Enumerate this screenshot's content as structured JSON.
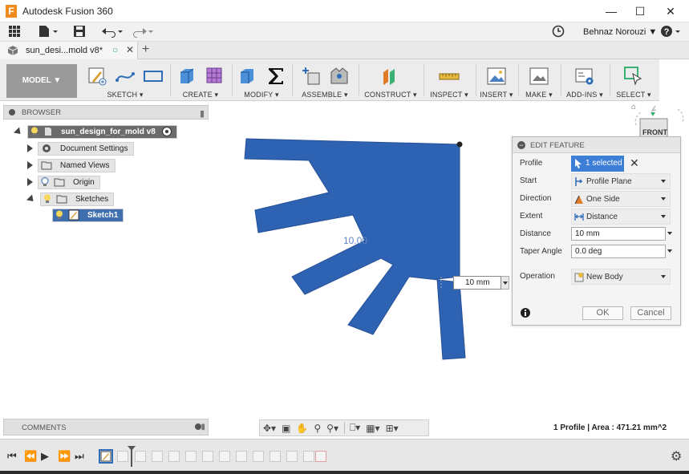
{
  "window": {
    "title": "Autodesk Fusion 360",
    "logo_letter": "F"
  },
  "qat": {
    "user": "Behnaz Norouzi ▼",
    "help": "?"
  },
  "tabs": {
    "document_title": "sun_desi...mold v8*",
    "plus": "+"
  },
  "ribbon": {
    "workspace": "MODEL ▼",
    "groups": [
      {
        "label": "SKETCH ▾"
      },
      {
        "label": "CREATE ▾"
      },
      {
        "label": "MODIFY ▾"
      },
      {
        "label": "ASSEMBLE ▾"
      },
      {
        "label": "CONSTRUCT ▾"
      },
      {
        "label": "INSPECT ▾"
      },
      {
        "label": "INSERT ▾"
      },
      {
        "label": "MAKE ▾"
      },
      {
        "label": "ADD-INS ▾"
      },
      {
        "label": "SELECT ▾"
      }
    ]
  },
  "browser": {
    "title": "BROWSER",
    "root": "sun_design_for_mold v8",
    "items": [
      "Document Settings",
      "Named Views",
      "Origin",
      "Sketches"
    ],
    "sketch": "Sketch1"
  },
  "viewcube": {
    "label": "FRONT"
  },
  "canvas": {
    "dimension_ghost": "10.00",
    "dimension_value": "10 mm"
  },
  "edit_feature": {
    "title": "EDIT FEATURE",
    "profile_label": "Profile",
    "profile_value": "1 selected",
    "start_label": "Start",
    "start_value": "Profile Plane",
    "direction_label": "Direction",
    "direction_value": "One Side",
    "extent_label": "Extent",
    "extent_value": "Distance",
    "distance_label": "Distance",
    "distance_value": "10 mm",
    "taper_label": "Taper Angle",
    "taper_value": "0.0 deg",
    "operation_label": "Operation",
    "operation_value": "New Body",
    "ok": "OK",
    "cancel": "Cancel"
  },
  "bottom": {
    "comments": "COMMENTS",
    "status": "1 Profile | Area : 471.21 mm^2"
  },
  "colors": {
    "body_fill": "#2e63b3",
    "accent": "#3d7ed6",
    "selected_node": "#3f6fae"
  }
}
